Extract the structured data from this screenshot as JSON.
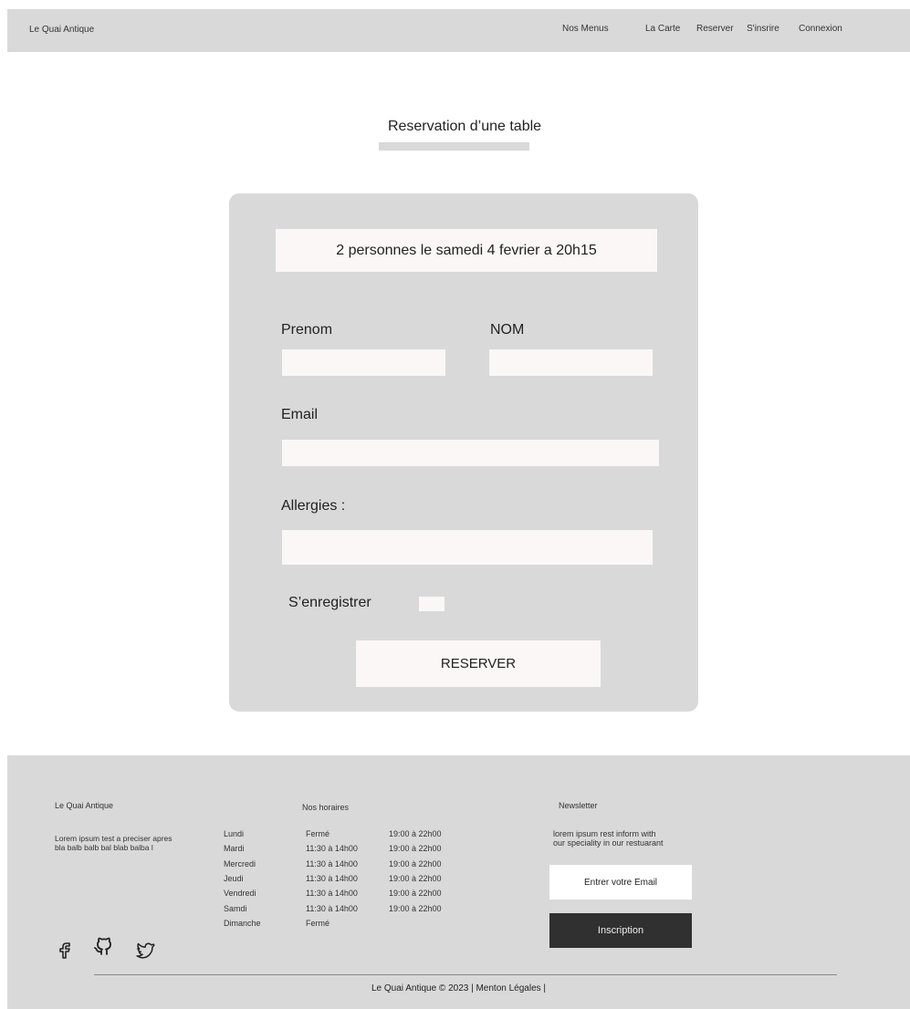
{
  "header": {
    "brand": "Le Quai Antique",
    "nav": [
      "Nos Menus",
      "La Carte",
      "Reserver",
      "S'insrire",
      "Connexion"
    ]
  },
  "page": {
    "title": "Reservation d’une table"
  },
  "form": {
    "summary": "2 personnes le samedi 4 fevrier a 20h15",
    "prenom_label": "Prenom",
    "nom_label": "NOM",
    "email_label": "Email",
    "allergies_label": "Allergies :",
    "register_label": "S’enregistrer",
    "reserve_button": "RESERVER",
    "prenom_value": "",
    "nom_value": "",
    "email_value": "",
    "allergies_value": "",
    "register_checked": false
  },
  "footer": {
    "brand": "Le Quai Antique",
    "description": "Lorem ipsum test a preciser apres bla balb balb bal blab balba l",
    "hours_title": "Nos horaires",
    "hours": [
      {
        "day": "Lundi",
        "lunch": "Fermé",
        "dinner": "19:00 à 22h00"
      },
      {
        "day": "Mardi",
        "lunch": "11:30 à 14h00",
        "dinner": "19:00 à 22h00"
      },
      {
        "day": "Mercredi",
        "lunch": "11:30 à 14h00",
        "dinner": "19:00 à 22h00"
      },
      {
        "day": "Jeudi",
        "lunch": "11:30 à 14h00",
        "dinner": "19:00 à 22h00"
      },
      {
        "day": "Vendredi",
        "lunch": "11:30 à 14h00",
        "dinner": "19:00 à 22h00"
      },
      {
        "day": "Samdi",
        "lunch": "11:30 à 14h00",
        "dinner": "19:00 à 22h00"
      },
      {
        "day": "Dimanche",
        "lunch": "Fermé",
        "dinner": ""
      }
    ],
    "newsletter_title": "Newsletter",
    "newsletter_text_1": "lorem ipsum rest inform with",
    "newsletter_text_2": "our speciality in our restuarant",
    "email_placeholder": "Entrer votre Email",
    "subscribe_button": "Inscription",
    "social_icons": [
      "facebook-icon",
      "github-icon",
      "twitter-icon"
    ],
    "copyright": "Le Quai Antique © 2023 | Menton Légales |"
  },
  "colors": {
    "panel": "#d9d9d9",
    "field": "#faf7f6",
    "dark_button": "#303030"
  }
}
